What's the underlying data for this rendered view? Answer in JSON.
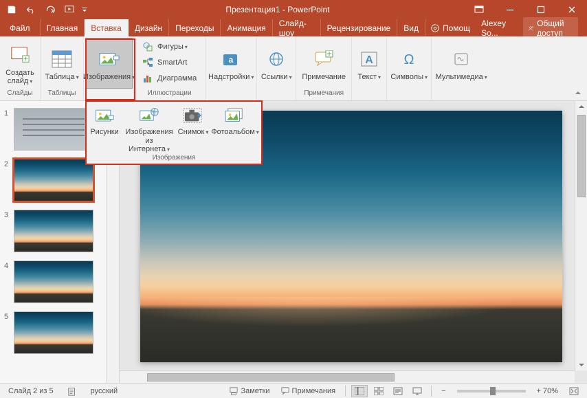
{
  "title": "Презентация1 - PowerPoint",
  "qat": {
    "save": "save",
    "undo": "undo",
    "redo": "redo",
    "start": "start"
  },
  "tabs": {
    "file": "Файл",
    "home": "Главная",
    "insert": "Вставка",
    "design": "Дизайн",
    "transitions": "Переходы",
    "animations": "Анимация",
    "slideshow": "Слайд-шоу",
    "review": "Рецензирование",
    "view": "Вид",
    "help": "Помощ"
  },
  "user": "Alexey So...",
  "share": "Общий доступ",
  "ribbon": {
    "new_slide": "Создать слайд",
    "slides_group": "Слайды",
    "table": "Таблица",
    "tables_group": "Таблицы",
    "images": "Изображения",
    "shapes": "Фигуры",
    "smartart": "SmartArt",
    "chart": "Диаграмма",
    "illustrations_group": "Иллюстрации",
    "addins": "Надстройки",
    "links": "Ссылки",
    "comment": "Примечание",
    "comments_group": "Примечания",
    "text": "Текст",
    "symbols": "Символы",
    "media": "Мультимедиа"
  },
  "images_dd": {
    "pictures": "Рисунки",
    "online": "Изображения из Интернета",
    "screenshot": "Снимок",
    "album": "Фотоальбом",
    "group": "Изображения"
  },
  "thumbs": [
    "1",
    "2",
    "3",
    "4",
    "5"
  ],
  "status": {
    "slide_counter": "Слайд 2 из 5",
    "lang": "русский",
    "notes": "Заметки",
    "comments": "Примечания",
    "zoom_pct": "+ 70%"
  }
}
